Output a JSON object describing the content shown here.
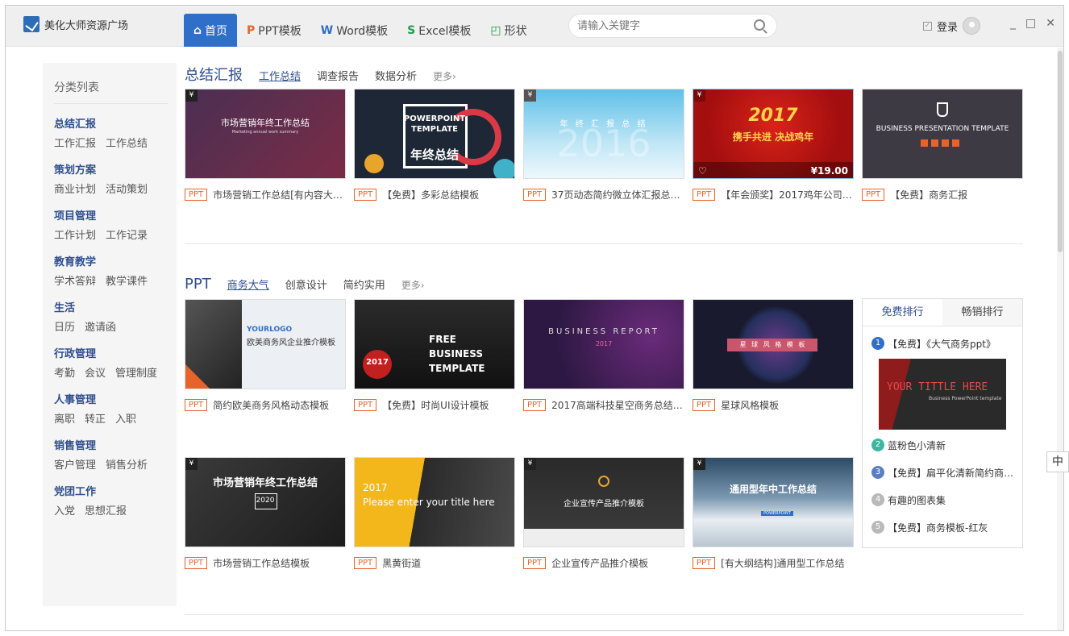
{
  "app": {
    "title": "美化大师资源广场"
  },
  "nav": {
    "items": [
      {
        "label": "首页",
        "icon": "home-icon"
      },
      {
        "label": "PPT模板",
        "icon": "ppt-icon"
      },
      {
        "label": "Word模板",
        "icon": "word-icon"
      },
      {
        "label": "Excel模板",
        "icon": "excel-icon"
      },
      {
        "label": "形状",
        "icon": "shape-icon"
      }
    ]
  },
  "search": {
    "placeholder": "请输入关键字"
  },
  "user": {
    "login_label": "登录"
  },
  "window_controls": {
    "minimize": "_",
    "maximize": "□",
    "close": "✕"
  },
  "sidebar": {
    "title": "分类列表",
    "categories": [
      {
        "head": "总结汇报",
        "subs": [
          "工作汇报",
          "工作总结"
        ]
      },
      {
        "head": "策划方案",
        "subs": [
          "商业计划",
          "活动策划"
        ]
      },
      {
        "head": "项目管理",
        "subs": [
          "工作计划",
          "工作记录"
        ]
      },
      {
        "head": "教育教学",
        "subs": [
          "学术答辩",
          "教学课件"
        ]
      },
      {
        "head": "生活",
        "subs": [
          "日历",
          "邀请函"
        ]
      },
      {
        "head": "行政管理",
        "subs": [
          "考勤",
          "会议",
          "管理制度"
        ]
      },
      {
        "head": "人事管理",
        "subs": [
          "离职",
          "转正",
          "入职"
        ]
      },
      {
        "head": "销售管理",
        "subs": [
          "客户管理",
          "销售分析"
        ]
      },
      {
        "head": "党团工作",
        "subs": [
          "入党",
          "思想汇报"
        ]
      }
    ]
  },
  "section1": {
    "title": "总结汇报",
    "tabs": [
      "工作总结",
      "调查报告",
      "数据分析"
    ],
    "more": "更多›",
    "cards": [
      {
        "badge": "PPT",
        "caption": "市场营销工作总结[有内容大…",
        "thumb_title": "市场营销年终工作总结",
        "thumb_sub": "Marketing annual work summary"
      },
      {
        "badge": "PPT",
        "caption": "【免费】多彩总结模板",
        "thumb_title": "POWERPOINT TEMPLATE",
        "thumb_sub": "年终总结"
      },
      {
        "badge": "PPT",
        "caption": "37页动态简约微立体汇报总…",
        "thumb_title": "年 终 汇 报 总 结",
        "thumb_sub": "2016"
      },
      {
        "badge": "PPT",
        "caption": "【年会颁奖】2017鸡年公司…",
        "thumb_title": "2017",
        "thumb_sub": "携手共进 决战鸡年",
        "price": "¥19.00"
      },
      {
        "badge": "PPT",
        "caption": "【免费】商务汇报",
        "thumb_title": "BUSINESS PRESENTATION TEMPLATE",
        "thumb_sub": ""
      }
    ]
  },
  "section2": {
    "title": "PPT",
    "tabs": [
      "商务大气",
      "创意设计",
      "简约实用"
    ],
    "more": "更多›",
    "cards": [
      {
        "badge": "PPT",
        "caption": "简约欧美商务风格动态模板",
        "thumb_title": "YOURLOGO",
        "thumb_sub": "欧美商务风企业推介模板"
      },
      {
        "badge": "PPT",
        "caption": "【免费】时尚UI设计模板",
        "thumb_title": "FREE BUSINESS TEMPLATE",
        "thumb_sub": "2017"
      },
      {
        "badge": "PPT",
        "caption": "2017高端科技星空商务总结…",
        "thumb_title": "BUSINESS REPORT",
        "thumb_sub": "2017"
      },
      {
        "badge": "PPT",
        "caption": "星球风格模板",
        "thumb_title": "星 球 风 格 模 板",
        "thumb_sub": ""
      },
      {
        "badge": "PPT",
        "caption": "市场营销工作总结模板",
        "thumb_title": "市场营销年终工作总结",
        "thumb_sub": "2020"
      },
      {
        "badge": "PPT",
        "caption": "黑黄街道",
        "thumb_title": "Please enter your title here",
        "thumb_sub": "2017"
      },
      {
        "badge": "PPT",
        "caption": "企业宣传产品推介模板",
        "thumb_title": "企业宣传产品推介模板",
        "thumb_sub": ""
      },
      {
        "badge": "PPT",
        "caption": "[有大纲结构]通用型工作总结",
        "thumb_title": "通用型年中工作总结",
        "thumb_sub": "POWERPOINT"
      }
    ]
  },
  "ranking": {
    "tabs": [
      "免费排行",
      "畅销排行"
    ],
    "items": [
      {
        "num": "1",
        "text": "【免费】《大气商务ppt》",
        "color": "#2f6fc9"
      },
      {
        "num": "2",
        "text": "蓝粉色小清新",
        "color": "#3bb7a0"
      },
      {
        "num": "3",
        "text": "【免费】扁平化清新简约商…",
        "color": "#5b7fc0"
      },
      {
        "num": "4",
        "text": "有趣的图表集",
        "color": "#b9b9b9"
      },
      {
        "num": "5",
        "text": "【免费】商务模板-红灰",
        "color": "#b9b9b9"
      }
    ],
    "thumb_title": "YOUR TITTLE HERE",
    "thumb_sub": "Business PowerPoint template"
  },
  "ime": {
    "label": "中"
  }
}
